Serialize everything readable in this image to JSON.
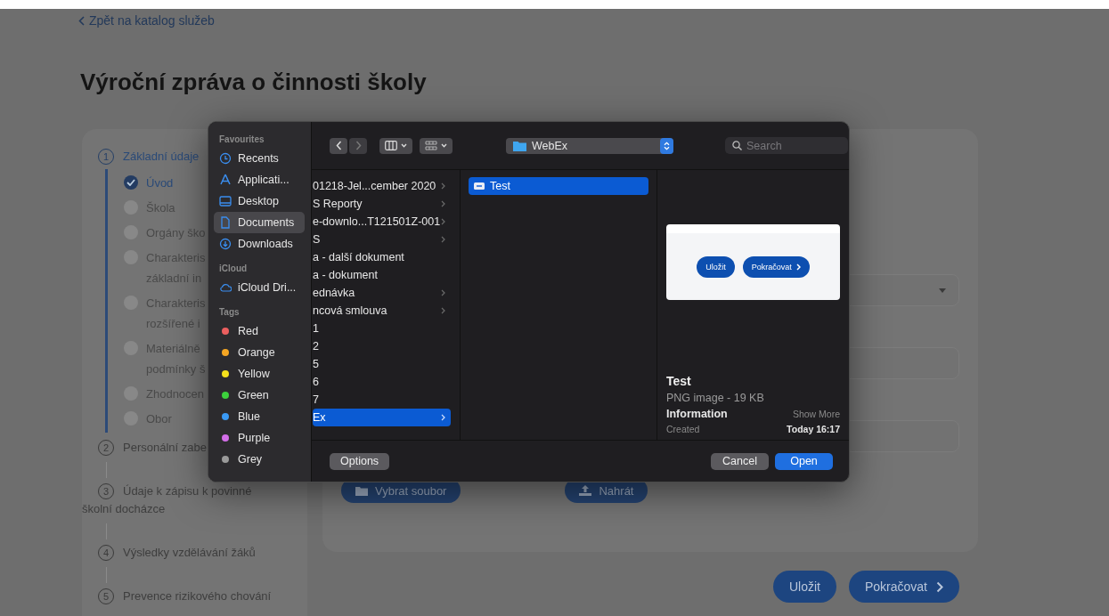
{
  "page": {
    "back_link": "Zpět na katalog služeb",
    "title": "Výroční zpráva o činnosti školy"
  },
  "steps": [
    {
      "number": "1",
      "lines": [
        "Základní údaje"
      ],
      "selected": true,
      "substeps": [
        {
          "lines": [
            "Úvod"
          ],
          "checked": true
        },
        {
          "lines": [
            "Škola"
          ],
          "checked": false
        },
        {
          "lines": [
            "Orgány ško"
          ],
          "checked": false
        },
        {
          "lines": [
            "Charakteris",
            "základní in"
          ],
          "checked": false
        },
        {
          "lines": [
            "Charakteris",
            "rozšířené i"
          ],
          "checked": false
        },
        {
          "lines": [
            "Materiálně",
            "podmínky š"
          ],
          "checked": false
        },
        {
          "lines": [
            "Zhodnocen"
          ],
          "checked": false
        },
        {
          "lines": [
            "Obor"
          ],
          "checked": false
        }
      ]
    },
    {
      "number": "2",
      "lines": [
        "Personální zabe"
      ],
      "selected": false
    },
    {
      "number": "3",
      "lines": [
        "Údaje k zápisu k povinné",
        "školní docházce"
      ],
      "selected": false
    },
    {
      "number": "4",
      "lines": [
        "Výsledky vzdělávání žáků"
      ],
      "selected": false
    },
    {
      "number": "5",
      "lines": [
        "Prevence rizikového chování"
      ],
      "selected": false
    }
  ],
  "form": {
    "upload_buttons": [
      {
        "label": "Vybrat soubor"
      },
      {
        "label": "Nahrát"
      }
    ],
    "actions": [
      {
        "label": "Uložit",
        "kind": "plain"
      },
      {
        "label": "Pokračovat",
        "kind": "next"
      }
    ]
  },
  "file_dialog": {
    "sidebar": [
      {
        "heading": "Favourites",
        "items": [
          {
            "label": "Recents",
            "kind": "place",
            "selected": false
          },
          {
            "label": "Applicati...",
            "kind": "place",
            "selected": false
          },
          {
            "label": "Desktop",
            "kind": "place",
            "selected": false
          },
          {
            "label": "Documents",
            "kind": "place",
            "selected": true
          },
          {
            "label": "Downloads",
            "kind": "place",
            "selected": false
          }
        ]
      },
      {
        "heading": "iCloud",
        "items": [
          {
            "label": "iCloud Dri...",
            "kind": "place",
            "selected": false
          }
        ]
      },
      {
        "heading": "Tags",
        "items": [
          {
            "label": "Red",
            "kind": "tag",
            "color": "#ec5f5f",
            "selected": false
          },
          {
            "label": "Orange",
            "kind": "tag",
            "color": "#f5a623",
            "selected": false
          },
          {
            "label": "Yellow",
            "kind": "tag",
            "color": "#f5e11c",
            "selected": false
          },
          {
            "label": "Green",
            "kind": "tag",
            "color": "#3cd03c",
            "selected": false
          },
          {
            "label": "Blue",
            "kind": "tag",
            "color": "#3a9af5",
            "selected": false
          },
          {
            "label": "Purple",
            "kind": "tag",
            "color": "#d36ee8",
            "selected": false
          },
          {
            "label": "Grey",
            "kind": "tag",
            "color": "#9a9a9a",
            "selected": false
          }
        ]
      }
    ],
    "location": "WebEx",
    "search": {
      "placeholder": "Search"
    },
    "columns": [
      [
        {
          "label": "01218-Jel...cember 2020",
          "folder": true,
          "selected": false
        },
        {
          "label": "S Reporty",
          "folder": true,
          "selected": false
        },
        {
          "label": "e-downlo...T121501Z-001",
          "folder": true,
          "selected": false
        },
        {
          "label": "S",
          "folder": true,
          "selected": false
        },
        {
          "label": "a - další dokument",
          "folder": false,
          "selected": false
        },
        {
          "label": "a - dokument",
          "folder": false,
          "selected": false
        },
        {
          "label": "ednávka",
          "folder": true,
          "selected": false
        },
        {
          "label": "ncová smlouva",
          "folder": true,
          "selected": false
        },
        {
          "label": "1",
          "folder": false,
          "selected": false
        },
        {
          "label": "2",
          "folder": false,
          "selected": false
        },
        {
          "label": "5",
          "folder": false,
          "selected": false
        },
        {
          "label": "6",
          "folder": false,
          "selected": false
        },
        {
          "label": "7",
          "folder": false,
          "selected": false
        },
        {
          "label": "Ex",
          "folder": true,
          "selected": true
        }
      ],
      [
        {
          "label": "Test",
          "folder": false,
          "selected": true
        }
      ]
    ],
    "preview": {
      "buttons": [
        {
          "label": "Uložit",
          "kind": "plain"
        },
        {
          "label": "Pokračovat",
          "kind": "next"
        }
      ],
      "name": "Test",
      "type": "PNG image - 19 KB",
      "info_heading": "Information",
      "show_more": "Show More",
      "fields": [
        {
          "label": "Created",
          "value": "Today 16:17"
        }
      ]
    },
    "buttons": {
      "options": "Options",
      "cancel": "Cancel",
      "open": "Open"
    }
  }
}
